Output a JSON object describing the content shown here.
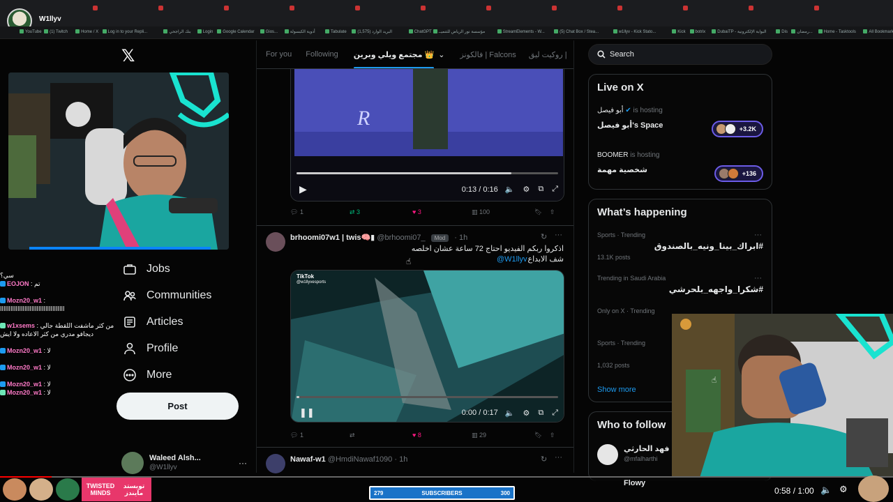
{
  "browser": {
    "channel_name": "W1llyv",
    "tabs": [
      "",
      "",
      "",
      "",
      "",
      "",
      "",
      "",
      "",
      "",
      "",
      ""
    ],
    "url": "",
    "bookmarks": [
      "YouTube",
      "(1) Twitch",
      "Home / X",
      "Log in to your Repli...",
      "بنك الراجحي",
      "Login",
      "Google Calendar",
      "Gios...",
      "أدوية الكبسولة",
      "Tabulate",
      "البريد الوارد (1,575)",
      "ChatGPT",
      "مؤسسة نور الرياض للتنميــ",
      "StreamElements - W...",
      "(5) Chat Box / Stea...",
      "w1llyv - Kick Stato...",
      "Kick",
      "botrix",
      "DubaiTP - البوابة الإلكترونية",
      "Dis",
      "رمضان...",
      "Home - Tasktools",
      "All Bookmarks"
    ]
  },
  "sidebar": {
    "nav": [
      {
        "label": "Jobs",
        "icon": "briefcase-icon"
      },
      {
        "label": "Communities",
        "icon": "communities-icon"
      },
      {
        "label": "Articles",
        "icon": "articles-icon"
      },
      {
        "label": "Profile",
        "icon": "profile-icon"
      },
      {
        "label": "More",
        "icon": "more-icon"
      }
    ],
    "post_label": "Post",
    "account": {
      "name": "Waleed Alsh...",
      "handle": "@W1llyv"
    }
  },
  "feed": {
    "tabs": [
      "For you",
      "Following",
      "مجتمع ويلي وبرين 👑",
      "فالكونز | Falcons",
      "روكيت ليق |"
    ],
    "tweet1": {
      "video_time": "0:13 / 0:16",
      "actions": {
        "replies": "1",
        "reposts": "3",
        "likes": "3",
        "views": "100"
      }
    },
    "tweet2": {
      "name": "brhoomi07w1 | twis🧠▮",
      "handle": "@brhoomi07_",
      "badge": "Mod",
      "time": "· 1h",
      "text_line1": "اذكروا ربكم الفيديو احتاج 72 ساعة عشان اخلصه",
      "text_line2": "شف الابداع",
      "mention": "@W1llyv",
      "video_watermark": "TikTok",
      "video_handle": "@w1llyvesports",
      "video_time": "0:00 / 0:17",
      "actions": {
        "replies": "1",
        "reposts": "",
        "likes": "8",
        "views": "29"
      }
    },
    "tweet3": {
      "name": "Nawaf-w1",
      "handle": "@HmdiNawaf1090",
      "time": "· 1h"
    }
  },
  "right": {
    "search_placeholder": "Search",
    "live_title": "Live on X",
    "live": [
      {
        "host": "أبو فيصل",
        "status": "is hosting",
        "space": "أبو فيصل's Space",
        "count": "+3.2K"
      },
      {
        "host": "BOOMER",
        "status": "is hosting",
        "space": "شخصية مهمة",
        "count": "+136"
      }
    ],
    "happening_title": "What’s happening",
    "trends": [
      {
        "category": "Sports · Trending",
        "name": "#ابراك_بينا_ونيه_بالصندوق",
        "count": "13.1K posts"
      },
      {
        "category": "Trending in Saudi Arabia",
        "name": "#شكرا_واجهه_بلحرشي",
        "count": ""
      },
      {
        "category": "Only on X · Trending",
        "name": "",
        "count": ""
      },
      {
        "category": "Sports · Trending",
        "name": "",
        "count": "1,032 posts"
      }
    ],
    "show_more": "Show more",
    "follow_title": "Who to follow",
    "follow": [
      {
        "name": "محمد فهد الحارثي",
        "handle": "@mfalharthi"
      },
      {
        "name": "Flowy",
        "handle": ""
      }
    ]
  },
  "chat": [
    {
      "user": "",
      "msg": "سي؟"
    },
    {
      "user": "EOJON",
      "msg": ": تم"
    },
    {
      "user": "",
      "msg": ""
    },
    {
      "user": "Mozn20_w1",
      "msg": ":"
    },
    {
      "user": "",
      "msg": "ااااااااااااااااااااااااااااااااااااا"
    },
    {
      "user": "",
      "msg": ""
    },
    {
      "user": "w1xsems",
      "msg": ": من كثر ماشفت اللقطة جالي"
    },
    {
      "user": "",
      "msg": "ديجافو مدري من كثر الاعاده ولا ايش"
    },
    {
      "user": "",
      "msg": ""
    },
    {
      "user": "Mozn20_w1",
      "msg": ": لا"
    },
    {
      "user": "",
      "msg": ""
    },
    {
      "user": "Mozn20_w1",
      "msg": ": لا"
    },
    {
      "user": "",
      "msg": ""
    },
    {
      "user": "Mozn20_w1",
      "msg": ": لا"
    },
    {
      "user": "Mozn20_w1",
      "msg": ": لا"
    }
  ],
  "overlay": {
    "subs_current": "279",
    "subs_label": "SUBSCRIBERS",
    "subs_goal": "300",
    "subs_progress": 0.93,
    "sponsor_en": "TWISTED MINDS",
    "sponsor_ar": "تويستد مايندز",
    "video_time": "0:58 / 1:00",
    "video_progress": 0.058
  },
  "colors": {
    "accent": "#1d9bf0",
    "like": "#f91880",
    "bg": "#000000",
    "sponsor": "#e8376b"
  }
}
